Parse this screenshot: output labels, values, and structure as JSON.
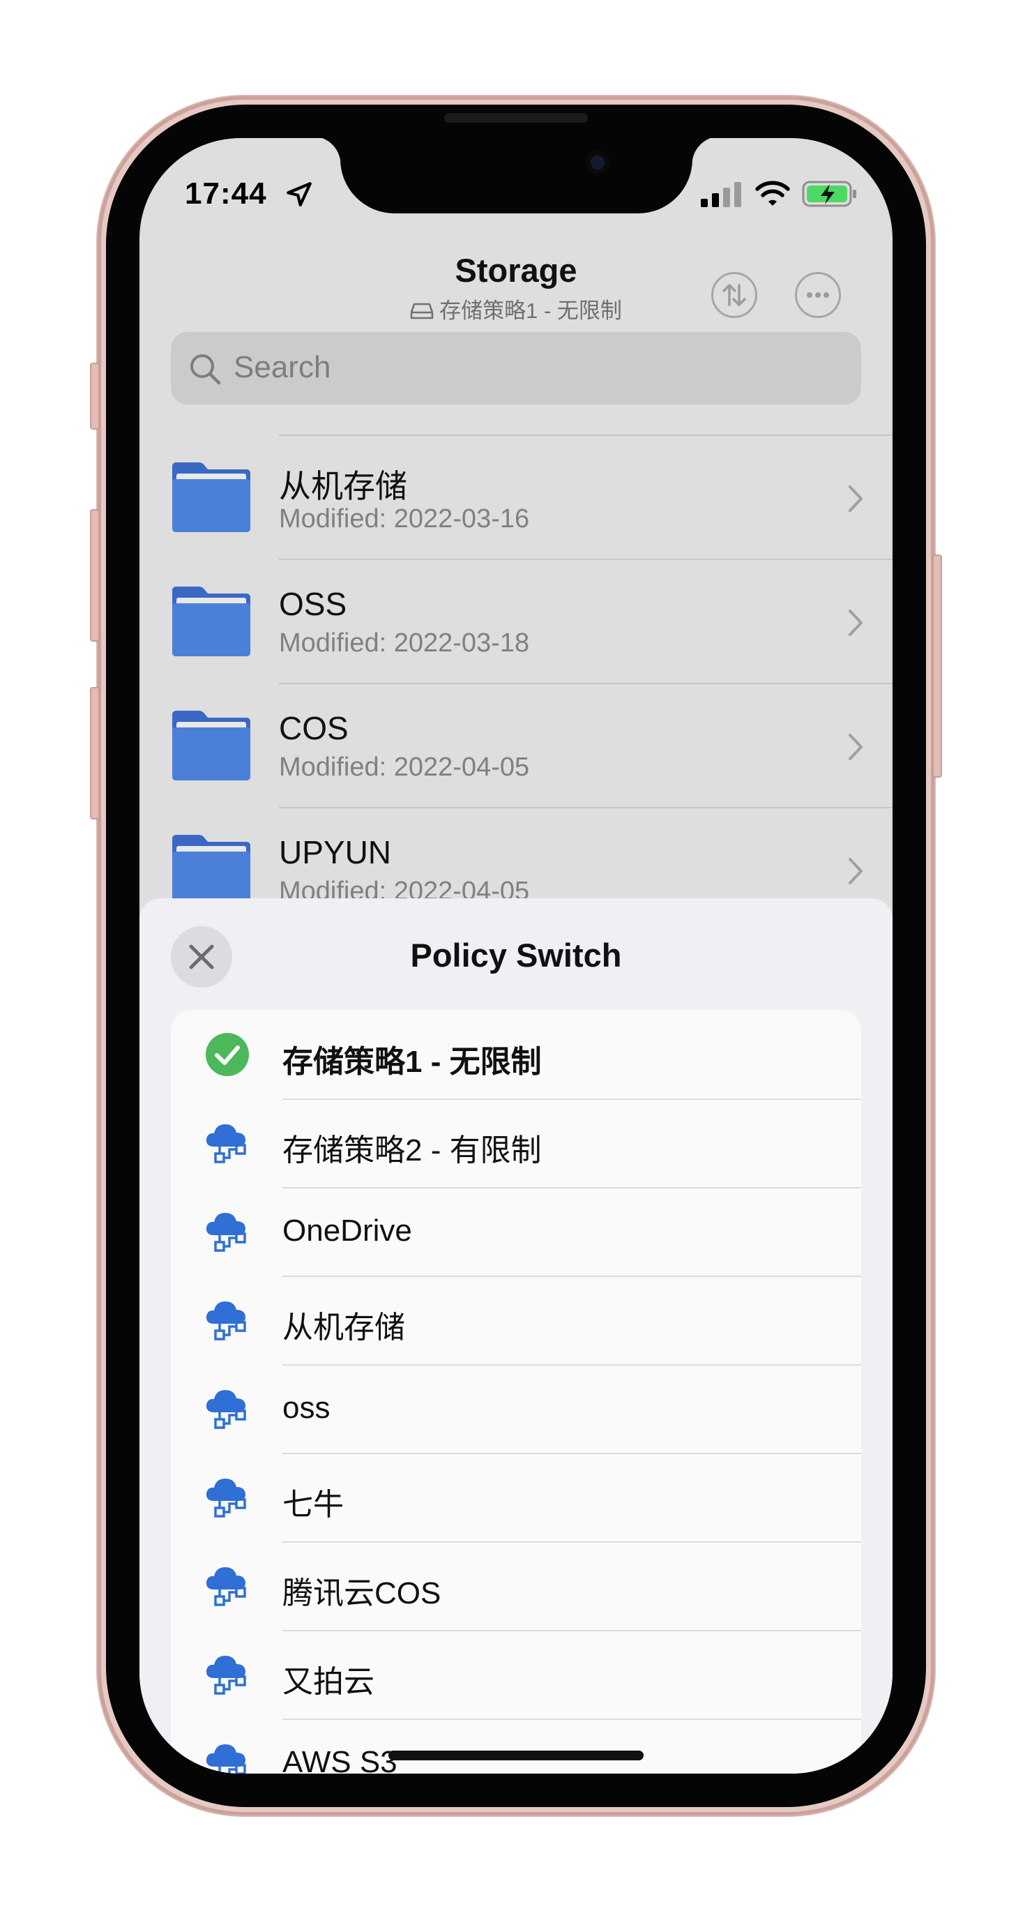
{
  "status_bar": {
    "time": "17:44"
  },
  "header": {
    "title": "Storage",
    "subtitle": "存储策略1 - 无限制"
  },
  "search": {
    "placeholder": "Search"
  },
  "files": [
    {
      "name": "从机存储",
      "modified": "Modified: 2022-03-16"
    },
    {
      "name": "OSS",
      "modified": "Modified: 2022-03-18"
    },
    {
      "name": "COS",
      "modified": "Modified: 2022-04-05"
    },
    {
      "name": "UPYUN",
      "modified": "Modified: 2022-04-05"
    }
  ],
  "sheet": {
    "title": "Policy Switch",
    "policies": [
      {
        "label": "存储策略1 - 无限制",
        "icon": "checkmark-circle-icon",
        "selected": true
      },
      {
        "label": "存储策略2 - 有限制",
        "icon": "cloud-network-icon",
        "selected": false
      },
      {
        "label": "OneDrive",
        "icon": "cloud-network-icon",
        "selected": false
      },
      {
        "label": "从机存储",
        "icon": "cloud-network-icon",
        "selected": false
      },
      {
        "label": "oss",
        "icon": "cloud-network-icon",
        "selected": false
      },
      {
        "label": "七牛",
        "icon": "cloud-network-icon",
        "selected": false
      },
      {
        "label": "腾讯云COS",
        "icon": "cloud-network-icon",
        "selected": false
      },
      {
        "label": "又拍云",
        "icon": "cloud-network-icon",
        "selected": false
      },
      {
        "label": "AWS S3",
        "icon": "cloud-network-icon",
        "selected": false
      }
    ]
  },
  "colors": {
    "accent": "#2f6fd6",
    "folder": "#3f72d2",
    "check": "#4cb85a",
    "phone_frame": "#e7c9c4"
  }
}
